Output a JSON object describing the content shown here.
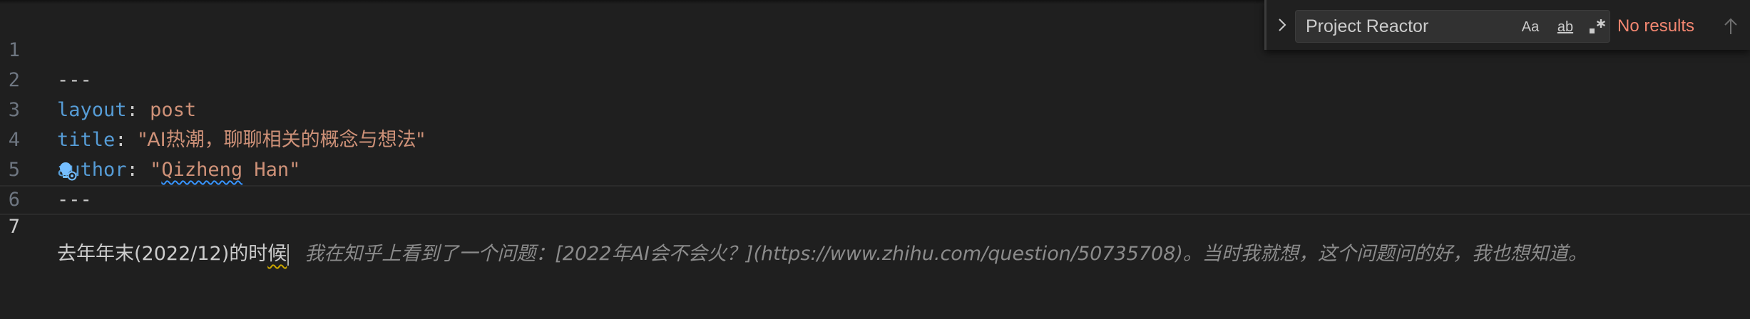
{
  "editor": {
    "lines": [
      {
        "num": "1",
        "dashes": "---"
      },
      {
        "num": "2",
        "key": "layout",
        "colon": ": ",
        "value": "post"
      },
      {
        "num": "3",
        "key": "title",
        "colon": ": ",
        "value": "\"AI热潮，聊聊相关的概念与想法\""
      },
      {
        "num": "4",
        "key": "author",
        "colon": ": ",
        "quote_open": "\"",
        "value_underlined": "Qizheng",
        "value_rest": " Han\""
      },
      {
        "num": "5",
        "dashes": "---"
      },
      {
        "num": "6"
      },
      {
        "num": "7",
        "text_before": "去年年末(2022/12)的时",
        "text_underlined": "候",
        "ghost_text": "我在知乎上看到了一个问题：[2022年AI会不会火？](https://www.zhihu.com/question/50735708)。当时我就想，这个问题问的好，我也想知道。"
      }
    ],
    "lightbulb_icon": "lightbulb-autofix-icon"
  },
  "find_widget": {
    "toggle_icon": "chevron-right-icon",
    "search_value": "Project Reactor",
    "match_case_label": "Aa",
    "whole_word_label": "ab",
    "regex_label": ".*",
    "results_text": "No results",
    "prev_icon": "arrow-up-icon"
  },
  "colors": {
    "background": "#1f1f1f",
    "keyword": "#569cd6",
    "string": "#ce9178",
    "line_number": "#6e7681",
    "no_results": "#f48771"
  }
}
